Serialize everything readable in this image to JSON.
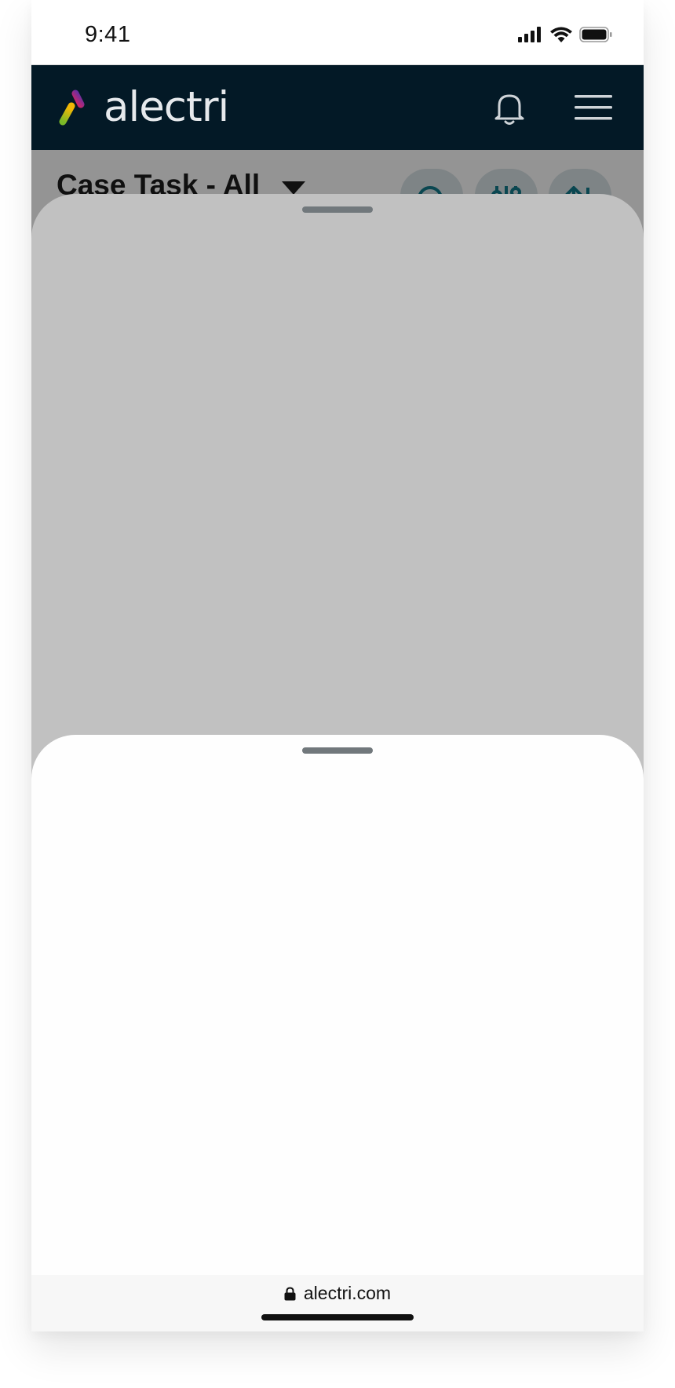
{
  "status_bar": {
    "time": "9:41"
  },
  "header": {
    "logo_text": "alectri",
    "icons": [
      "bell-icon",
      "hamburger-menu-icon"
    ]
  },
  "page": {
    "title": "Case Task - All",
    "action_icons": [
      "search-icon",
      "filter-sliders-icon",
      "sort-icon"
    ]
  },
  "browser": {
    "url": "alectri.com"
  },
  "colors": {
    "header_bg": "#031926",
    "scrim": "rgba(0,0,0,0.42)",
    "back_sheet": "#c1c1c1",
    "front_sheet": "#fefefe",
    "handle": "#71787c",
    "accent": "#127a8c"
  }
}
